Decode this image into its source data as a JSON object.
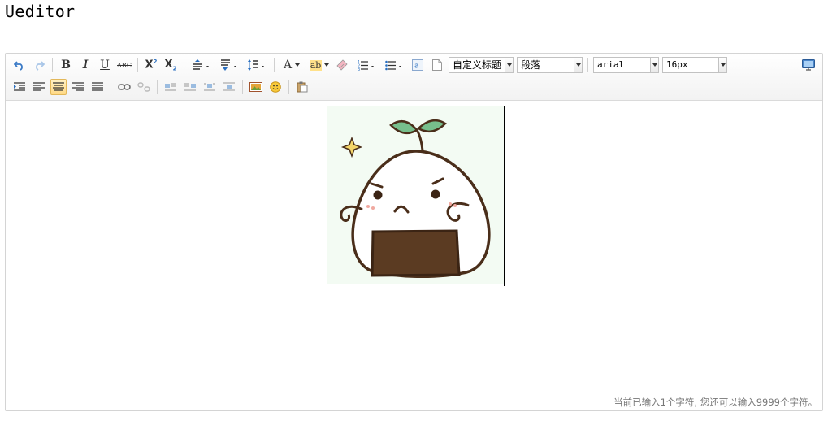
{
  "page": {
    "title": "Ueditor"
  },
  "toolbar": {
    "buttons": {
      "undo": "undo-icon",
      "redo": "redo-icon",
      "bold": "B",
      "italic": "I",
      "underline": "U",
      "strike": "ABC",
      "superscript": "X",
      "subscript": "X",
      "font_color": "A",
      "highlight": "ab"
    },
    "custom_heading": "自定义标题",
    "paragraph": "段落",
    "font_family": "arial",
    "font_size": "16px",
    "active_button": "align-center"
  },
  "content": {
    "image": {
      "alt_icon": "onigiri-sprout-image"
    }
  },
  "statusbar": {
    "text": "当前已输入1个字符, 您还可以输入9999个字符。"
  },
  "colors": {
    "accent": "#ffd985",
    "border": "#d4d4d4",
    "image_bg": "#f3fbf3",
    "leaf": "#77bf8c",
    "rice_outline": "#5b3b22"
  }
}
